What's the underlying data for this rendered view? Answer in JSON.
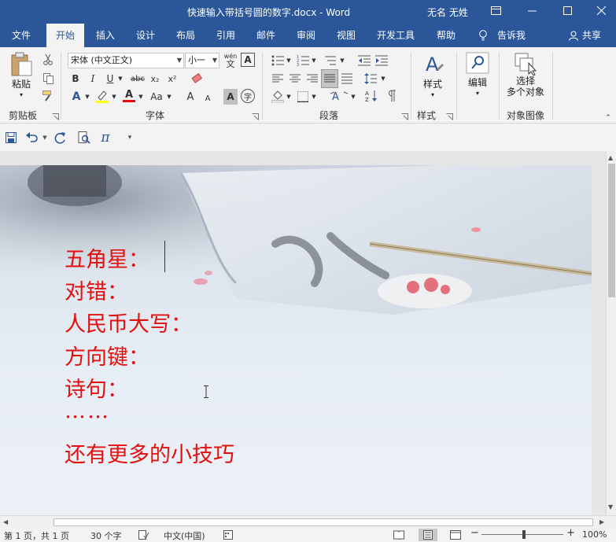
{
  "window": {
    "title": "快速输入带括号圆的数字.docx  -  Word",
    "user": "无名 无姓"
  },
  "tabs": [
    {
      "label": "文件"
    },
    {
      "label": "开始"
    },
    {
      "label": "插入"
    },
    {
      "label": "设计"
    },
    {
      "label": "布局"
    },
    {
      "label": "引用"
    },
    {
      "label": "邮件"
    },
    {
      "label": "审阅"
    },
    {
      "label": "视图"
    },
    {
      "label": "开发工具"
    },
    {
      "label": "帮助"
    },
    {
      "label": "告诉我"
    },
    {
      "label": "共享"
    }
  ],
  "ribbon": {
    "clipboard": {
      "label": "剪贴板",
      "paste": "粘贴"
    },
    "font": {
      "label": "字体",
      "font_name": "宋体 (中文正文)",
      "font_size": "小一",
      "wen": "wén",
      "wen_char": "文",
      "border_char": "A",
      "bold": "B",
      "italic": "I",
      "underline": "U",
      "strike": "abc",
      "sub": "x₂",
      "sup": "x²",
      "aa": "Aa",
      "grow": "A",
      "shrink": "A",
      "shade": "A",
      "enclose": "字"
    },
    "paragraph": {
      "label": "段落"
    },
    "styles": {
      "label": "样式",
      "button": "样式"
    },
    "editing": {
      "button": "编辑"
    },
    "select": {
      "label": "对象图像",
      "button_line1": "选择",
      "button_line2": "多个对象"
    }
  },
  "qat": {
    "pi": "π"
  },
  "document": {
    "lines": [
      "五角星：",
      "对错：",
      "人民币大写：",
      "方向键：",
      "诗句：",
      "……",
      "还有更多的小技巧"
    ]
  },
  "status": {
    "page": "第 1 页，共 1 页",
    "words": "30 个字",
    "language": "中文(中国)",
    "zoom": "100%"
  }
}
